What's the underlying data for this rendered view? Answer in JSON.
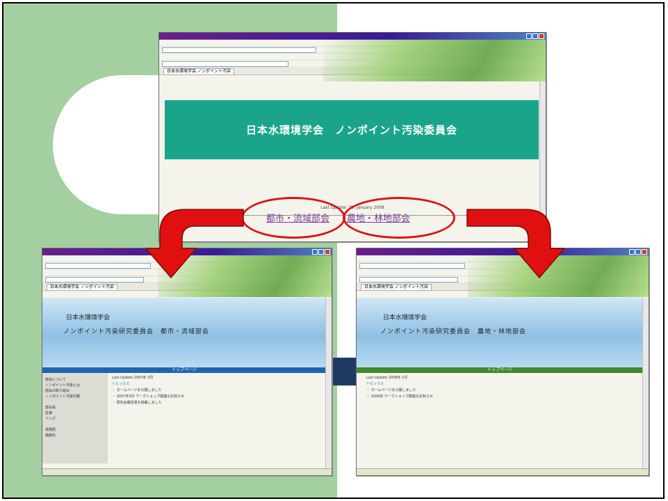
{
  "main_window": {
    "header_title": "日本水環境学会　ノンポイント汚染委員会",
    "last_updated": "Last Update: 30, January 2008",
    "tab_label": "日本水環境学会 ノンポイント汚染",
    "links": [
      "都市・流域部会",
      "農地・林地部会"
    ]
  },
  "left_window": {
    "tab_label": "日本水環境学会 ノンポイント汚染",
    "title1": "日本水環境学会",
    "title2": "ノンポイント汚染研究委員会　都市・流域部会",
    "nav_label": "トップページ",
    "sidebar_items": [
      "部会について",
      "ノンポイント汚染とは",
      "部会の取り組み",
      "ノンポイント汚染対策",
      "",
      "部会員",
      "名簿",
      "リンク",
      "",
      "事務局",
      "連絡先"
    ],
    "content_lines": [
      "Last Update 2007年 3月",
      "トピックス",
      "・ ホームページを公開しました",
      "・ 2007年3月 ワークショップ開催のお知らせ",
      "・ 研究会報告書を掲載しました"
    ],
    "accent": "#1f66b0"
  },
  "right_window": {
    "tab_label": "日本水環境学会 ノンポイント汚染",
    "title1": "日本水環境学会",
    "title2": "ノンポイント汚染研究委員会　農地・林地部会",
    "nav_label": "トップページ",
    "content_lines": [
      "Last Update 2008年 1月",
      "トピックス",
      "・ ホームページを公開しました",
      "・ 2008年 ワークショップ開催のお知らせ"
    ],
    "accent": "#3f8a2a"
  },
  "colors": {
    "green_panel": "#a4cfa0",
    "teal_header": "#1aa58a",
    "arrow_red": "#e01010",
    "navy": "#1f3b64"
  }
}
